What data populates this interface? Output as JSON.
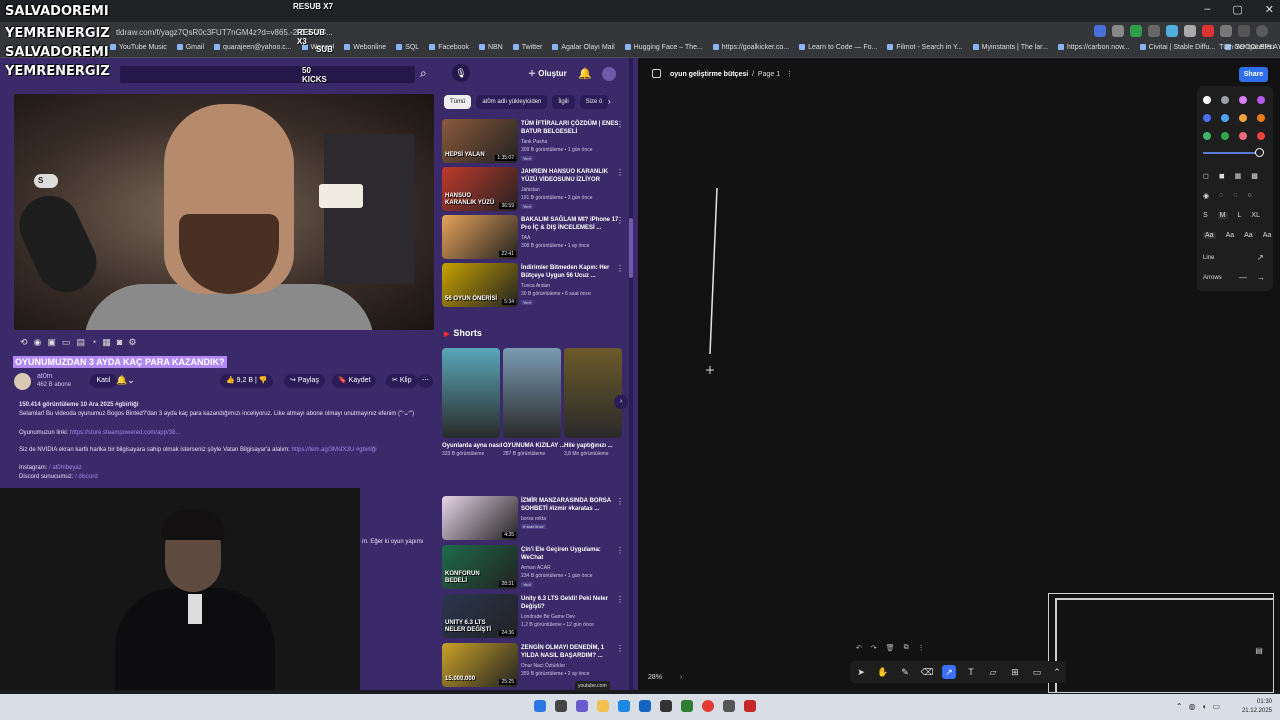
{
  "overlay": {
    "names": [
      "SALVADOREMI",
      "YEMRENERGIZ",
      "SALVADOREMI",
      "YEMRENERGIZ"
    ],
    "resub_top": "RESUB X7",
    "resub_sub": "RESUB X3",
    "sub": "SUB",
    "kicks": "50 KICKS"
  },
  "browser": {
    "url": "tldraw.com/f/yagz7QsR0c3FUT7nGM4z?d=v865.-2254.443...",
    "bookmarks": [
      "YouTube Music",
      "Gmail",
      "quarajeen@yahoo.c...",
      "Weanal",
      "Webonline",
      "SQL",
      "Facebook",
      "NBN",
      "Twitter",
      "Agalar Olayı Mail",
      "Hugging Face – The...",
      "https://goalkicker.co...",
      "Learn to Code — Fo...",
      "Filmot - Search in Y...",
      "Myinstants | The lar...",
      "https://carbon.now...",
      "Civitai | Stable Diffu...",
      "GOOGLEPLAY"
    ],
    "bookmarks_right": "Tüm Yer İşaretleri",
    "colors": {
      "accent": "#3b6ff5",
      "yt_bg": "#3a2a6a",
      "highlight": "#b288f5"
    }
  },
  "youtube": {
    "create_label": "Oluştur",
    "s_badge": "S",
    "video_title": "OYUNUMUZDAN 3 AYDA KAÇ PARA KAZANDIK?",
    "channel": {
      "name": "at0m",
      "subs": "462 B abone",
      "join": "Katıl"
    },
    "actions": {
      "likes": "9,2 B",
      "share": "Paylaş",
      "save": "Kaydet",
      "clip": "Klip"
    },
    "description": {
      "stats": "150.414 görüntüleme  10 Ara 2025  #gbirliği",
      "line1": "Selamlar! Bu videoda oyunumuz Bogos Binted?'dan 3 ayda kaç para kazandığımızı inceliyoruz. Like atmayı abone olmayı unutmayınız efenim (\"ᵔᴗᵔ\")",
      "game_label": "Oyunumuzun linki:",
      "game_link": "https://store.steampowered.com/app/38...",
      "nvidia": "Siz de NVIDIA ekran kartlı harika bir bilgisayara sahip olmak isterseniz şöyle Vatan Bilgisayar'a alalım:",
      "nvidia_link": "https://tem.ag/3MsfX3U #gbirliği",
      "instagram_label": "Instagram:",
      "instagram_link": "/ at0mbeyaz",
      "discord_label": "Discord sunucumuz:",
      "discord_link": "/ discord",
      "tail": "m. Eğer ki oyun yapımı"
    },
    "chips": [
      "Tümü",
      "at0m adlı yükleyiciden",
      "İlgili",
      "Size ö"
    ],
    "recommendations": [
      {
        "title": "TÜM İFTİRALARI ÇÖZDÜM | ENES BATUR BELGESELİ",
        "channel": "Tank Pasha",
        "meta": "309 B görüntüleme • 1 gün önce",
        "badge": "Yeni",
        "duration": "1:35:07",
        "thumb_text": "HEPSİ YALAN",
        "color": "#8a5a3a"
      },
      {
        "title": "JAHREIN HANSUO KARANLIK YÜZÜ VİDEOSUNU İZLİYOR",
        "channel": "Jahistan",
        "meta": "191 B görüntüleme • 3 gün önce",
        "badge": "Yeni",
        "duration": "36:59",
        "thumb_text": "HANSUO KARANLIK YÜZÜ",
        "color": "#c0392b"
      },
      {
        "title": "BAKALIM SAĞLAM MI? iPhone 17 Pro İÇ & DIŞ İNCELEMESİ ...",
        "channel": "TAA",
        "meta": "308 B görüntüleme • 1 ay önce",
        "badge": "",
        "duration": "22:41",
        "thumb_text": "",
        "color": "#e7a35a"
      },
      {
        "title": "İndirimler Bitmeden Kapın: Her Bütçeye Uygun 56 Ucuz ...",
        "channel": "Tunca Arslan",
        "meta": "30 B görüntüleme • 6 saat önce",
        "badge": "Yeni",
        "duration": "5:34",
        "thumb_text": "56 OYUN ÖNERİSİ",
        "color": "#c6a200"
      }
    ],
    "shorts_label": "Shorts",
    "shorts": [
      {
        "title": "Oyunlarda ayna nasıl ...",
        "views": "333 B görüntüleme",
        "color": "#5aa7b9"
      },
      {
        "title": "OYUNUMA KIZILAY ...",
        "views": "287 B görüntüleme",
        "color": "#7a9bb3"
      },
      {
        "title": "Hile yaptığınızı ...",
        "views": "3,8 Mn görüntüleme",
        "color": "#6b5a2a"
      }
    ],
    "recommendations2": [
      {
        "title": "İZMİR MANZARASINDA BORSA SOHBETİ #izmir #karatas ...",
        "channel": "borsa rokta",
        "meta": "",
        "badge": "6 saat önce",
        "duration": "4:35",
        "thumb_text": "",
        "color": "#e8d5e8"
      },
      {
        "title": "Çin'i Ele Geçiren Uygulama: WeChat",
        "channel": "Arman ACAR",
        "meta": "234 B görüntüleme • 1 gün önce",
        "badge": "Yeni",
        "duration": "28:31",
        "thumb_text": "KONFORUN BEDELİ",
        "color": "#1e6a4a"
      },
      {
        "title": "Unity 6.3 LTS Geldi! Peki Neler Değişti?",
        "channel": "Londrade Bir Game Dev",
        "meta": "1,2 B görüntüleme • 12 gün önce",
        "badge": "",
        "duration": "24:36",
        "thumb_text": "UNITY 6.3 LTS NELER DEĞİŞTİ",
        "color": "#2a3550"
      },
      {
        "title": "ZENGİN OLMAYI DENEDİM, 1 YILDA NASIL BAŞARDIM? ...",
        "channel": "Onur Naci Öztürkler",
        "meta": "359 B görüntüleme • 2 ay önce",
        "badge": "",
        "duration": "25:25",
        "thumb_text": "15.000.000",
        "color": "#c9a227"
      }
    ],
    "url_tip": "youtube.com"
  },
  "drawing": {
    "breadcrumb_project": "oyun geliştirme bütçesi",
    "breadcrumb_sep": "/",
    "breadcrumb_page": "Page 1",
    "share_label": "Share",
    "zoom": "28%",
    "sizes": [
      "S",
      "M",
      "L",
      "XL"
    ],
    "fonts": [
      "Aa",
      "Aa",
      "Aa",
      "Aa"
    ],
    "line_label": "Line",
    "arrows_label": "Arrows",
    "swatches": [
      "#ffffff",
      "#9aa0a6",
      "#d97ff7",
      "#b45cf0",
      "#4d6ff0",
      "#4fa4f5",
      "#f2a23a",
      "#f07b1d",
      "#3fb56b",
      "#2fa84f",
      "#f06a7a",
      "#e8433b"
    ]
  },
  "taskbar": {
    "time": "01:30",
    "date": "21.12.2025"
  }
}
